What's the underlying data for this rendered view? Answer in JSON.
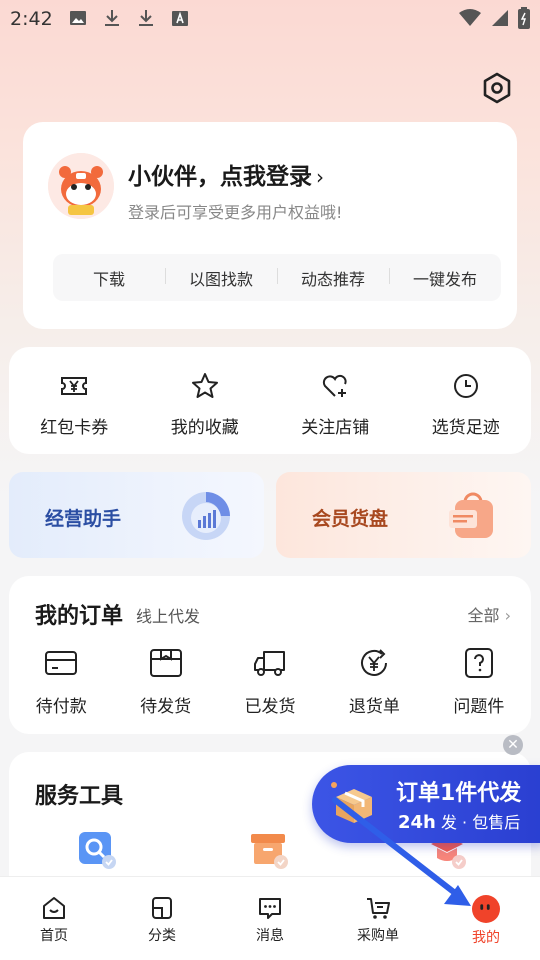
{
  "status_bar": {
    "time": "2:42"
  },
  "login_card": {
    "title": "小伙伴，点我登录",
    "subtitle": "登录后可享受更多用户权益哦!",
    "quick_actions": [
      "下载",
      "以图找款",
      "动态推荐",
      "一键发布"
    ]
  },
  "favorites": [
    "红包卡券",
    "我的收藏",
    "关注店铺",
    "选货足迹"
  ],
  "promos": {
    "left": "经营助手",
    "right": "会员货盘"
  },
  "orders": {
    "title": "我的订单",
    "subtitle": "线上代发",
    "all_label": "全部",
    "items": [
      "待付款",
      "待发货",
      "已发货",
      "退货单",
      "问题件"
    ]
  },
  "tools": {
    "title": "服务工具"
  },
  "float_banner": {
    "line1": "订单1件代发",
    "line2_strong": "24h",
    "line2_rest": "发 · 包售后"
  },
  "tabbar": [
    "首页",
    "分类",
    "消息",
    "采购单",
    "我的"
  ],
  "colors": {
    "accent": "#f0432a",
    "banner_blue": "#2a3fd1"
  }
}
